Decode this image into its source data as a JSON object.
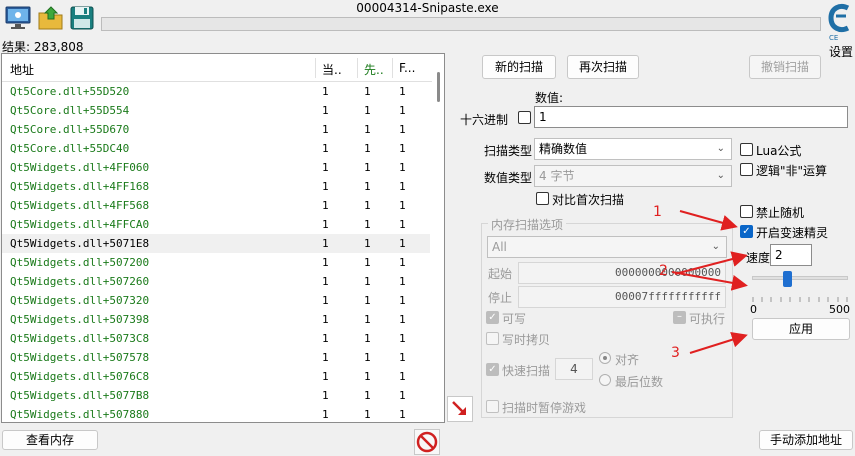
{
  "window": {
    "title": "00004314-Snipaste.exe"
  },
  "toolbar": {
    "icons": [
      "process-monitor-icon",
      "open-folder-icon",
      "save-disk-icon",
      "cheat-engine-logo"
    ]
  },
  "settings": {
    "label": "设置"
  },
  "results": {
    "count_label": "结果: 283,808"
  },
  "list": {
    "headers": [
      "地址",
      "当..",
      "先..",
      "F..."
    ],
    "rows": [
      [
        "Qt5Core.dll+55D520",
        "1",
        "1",
        "1"
      ],
      [
        "Qt5Core.dll+55D554",
        "1",
        "1",
        "1"
      ],
      [
        "Qt5Core.dll+55D670",
        "1",
        "1",
        "1"
      ],
      [
        "Qt5Core.dll+55DC40",
        "1",
        "1",
        "1"
      ],
      [
        "Qt5Widgets.dll+4FF060",
        "1",
        "1",
        "1"
      ],
      [
        "Qt5Widgets.dll+4FF168",
        "1",
        "1",
        "1"
      ],
      [
        "Qt5Widgets.dll+4FF568",
        "1",
        "1",
        "1"
      ],
      [
        "Qt5Widgets.dll+4FFCA0",
        "1",
        "1",
        "1"
      ],
      [
        "Qt5Widgets.dll+5071E8",
        "1",
        "1",
        "1"
      ],
      [
        "Qt5Widgets.dll+507200",
        "1",
        "1",
        "1"
      ],
      [
        "Qt5Widgets.dll+507260",
        "1",
        "1",
        "1"
      ],
      [
        "Qt5Widgets.dll+507320",
        "1",
        "1",
        "1"
      ],
      [
        "Qt5Widgets.dll+507398",
        "1",
        "1",
        "1"
      ],
      [
        "Qt5Widgets.dll+5073C8",
        "1",
        "1",
        "1"
      ],
      [
        "Qt5Widgets.dll+507578",
        "1",
        "1",
        "1"
      ],
      [
        "Qt5Widgets.dll+5076C8",
        "1",
        "1",
        "1"
      ],
      [
        "Qt5Widgets.dll+5077B8",
        "1",
        "1",
        "1"
      ],
      [
        "Qt5Widgets.dll+507880",
        "1",
        "1",
        "1"
      ]
    ]
  },
  "buttons": {
    "new_scan": "新的扫描",
    "next_scan": "再次扫描",
    "undo_scan": "撤销扫描",
    "view_memory": "查看内存",
    "add_address": "手动添加地址",
    "apply": "应用"
  },
  "value": {
    "label": "数值:",
    "hex_label": "十六进制",
    "current": "1"
  },
  "scan_type": {
    "label": "扫描类型",
    "selected": "精确数值"
  },
  "value_type": {
    "label": "数值类型",
    "selected": "4 字节"
  },
  "compare_first": {
    "label": "对比首次扫描"
  },
  "memory_options": {
    "title": "内存扫描选项",
    "region": "All",
    "start_label": "起始",
    "start_value": "0000000000000000",
    "stop_label": "停止",
    "stop_value": "00007fffffffffff",
    "writable": "可写",
    "executable": "可执行",
    "copy_on_write": "写时拷贝",
    "fast_scan": "快速扫描",
    "fast_scan_value": "4",
    "align": "对齐",
    "last_digits": "最后位数",
    "pause_game": "扫描时暂停游戏"
  },
  "right_options": {
    "lua": "Lua公式",
    "not_op": "逻辑\"非\"运算",
    "no_random": "禁止随机",
    "speedhack": "开启变速精灵"
  },
  "speed": {
    "label": "速度",
    "value": "2",
    "min_label": "0",
    "max_label": "500",
    "slider_fraction": 0.07
  },
  "annotations": [
    "1",
    "2",
    "3"
  ],
  "colors": {
    "annotation": "#e02020",
    "address_text": "#1a7a1a",
    "check_on": "#0a66c8"
  }
}
